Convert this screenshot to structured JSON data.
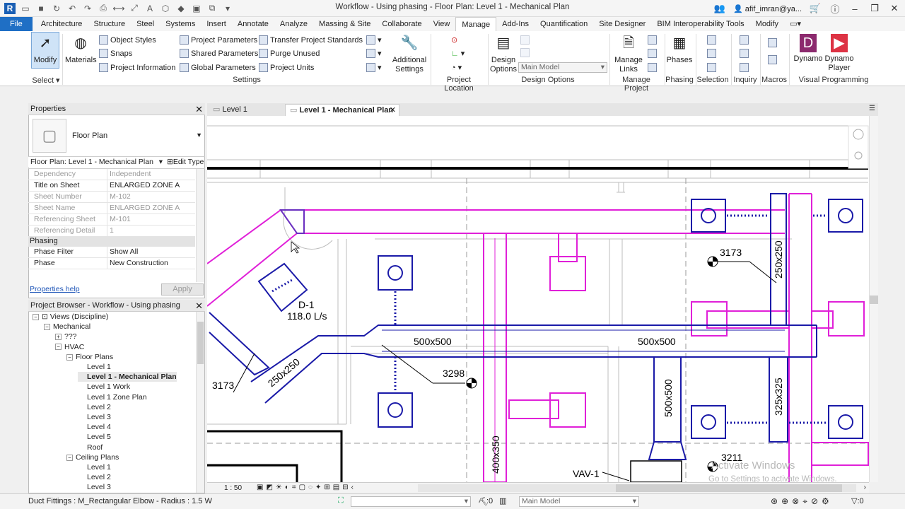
{
  "window": {
    "title": "Workflow - Using phasing - Floor Plan: Level 1 - Mechanical Plan",
    "user": "afif_imran@ya..."
  },
  "ribbon_tabs": [
    "File",
    "Architecture",
    "Structure",
    "Steel",
    "Systems",
    "Insert",
    "Annotate",
    "Analyze",
    "Massing & Site",
    "Collaborate",
    "View",
    "Manage",
    "Add-Ins",
    "Quantification",
    "Site Designer",
    "BIM Interoperability Tools",
    "Modify"
  ],
  "active_tab": "Manage",
  "ribbon": {
    "modify": "Modify",
    "select_group": "Select",
    "materials": "Materials",
    "object_styles": "Object  Styles",
    "snaps": "Snaps",
    "project_information": "Project  Information",
    "project_parameters": "Project  Parameters",
    "shared_parameters": "Shared  Parameters",
    "global_parameters": "Global  Parameters",
    "transfer_standards": "Transfer  Project Standards",
    "purge_unused": "Purge  Unused",
    "project_units": "Project  Units",
    "additional_settings_1": "Additional",
    "additional_settings_2": "Settings",
    "settings_group": "Settings",
    "project_location_group": "Project Location",
    "design_options_1": "Design",
    "design_options_2": "Options",
    "main_model": "Main Model",
    "design_options_group": "Design Options",
    "manage_links_1": "Manage",
    "manage_links_2": "Links",
    "manage_project_group": "Manage Project",
    "phases": "Phases",
    "phasing_group": "Phasing",
    "selection_group": "Selection",
    "inquiry_group": "Inquiry",
    "macros_group": "Macros",
    "dynamo": "Dynamo",
    "dynamo_player_1": "Dynamo",
    "dynamo_player_2": "Player",
    "visual_programming_group": "Visual Programming"
  },
  "properties": {
    "header": "Properties",
    "type_name": "Floor Plan",
    "selector": "Floor Plan: Level 1 - Mechanical Plan",
    "edit_type": "Edit Type",
    "rows": [
      {
        "k": "Dependency",
        "v": "Independent",
        "dim": true
      },
      {
        "k": "Title on Sheet",
        "v": "ENLARGED ZONE A",
        "dim": false
      },
      {
        "k": "Sheet Number",
        "v": "M-102",
        "dim": true
      },
      {
        "k": "Sheet Name",
        "v": "ENLARGED ZONE A",
        "dim": true
      },
      {
        "k": "Referencing Sheet",
        "v": "M-101",
        "dim": true
      },
      {
        "k": "Referencing Detail",
        "v": "1",
        "dim": true
      }
    ],
    "phasing_section": "Phasing",
    "phase_rows": [
      {
        "k": "Phase Filter",
        "v": "Show All"
      },
      {
        "k": "Phase",
        "v": "New Construction"
      }
    ],
    "help_link": "Properties help",
    "apply": "Apply"
  },
  "browser": {
    "header": "Project Browser - Workflow - Using phasing",
    "items": [
      {
        "label": "Views (Discipline)",
        "level": 0,
        "toggle": "−"
      },
      {
        "label": "Mechanical",
        "level": 1,
        "toggle": "−"
      },
      {
        "label": "???",
        "level": 2,
        "toggle": "+"
      },
      {
        "label": "HVAC",
        "level": 2,
        "toggle": "−"
      },
      {
        "label": "Floor Plans",
        "level": 3,
        "toggle": "−"
      },
      {
        "label": "Level 1",
        "level": 4,
        "toggle": ""
      },
      {
        "label": "Level 1 - Mechanical Plan",
        "level": 4,
        "toggle": "",
        "bold": true
      },
      {
        "label": "Level 1 Work",
        "level": 4,
        "toggle": ""
      },
      {
        "label": "Level 1 Zone Plan",
        "level": 4,
        "toggle": ""
      },
      {
        "label": "Level 2",
        "level": 4,
        "toggle": ""
      },
      {
        "label": "Level 3",
        "level": 4,
        "toggle": ""
      },
      {
        "label": "Level 4",
        "level": 4,
        "toggle": ""
      },
      {
        "label": "Level 5",
        "level": 4,
        "toggle": ""
      },
      {
        "label": "Roof",
        "level": 4,
        "toggle": ""
      },
      {
        "label": "Ceiling Plans",
        "level": 3,
        "toggle": "−"
      },
      {
        "label": "Level 1",
        "level": 4,
        "toggle": ""
      },
      {
        "label": "Level 2",
        "level": 4,
        "toggle": ""
      },
      {
        "label": "Level 3",
        "level": 4,
        "toggle": ""
      }
    ]
  },
  "view_tabs": [
    {
      "label": "Level 1",
      "active": false
    },
    {
      "label": "Level 1 - Mechanical Plan",
      "active": true
    }
  ],
  "drawing_labels": {
    "d1": "D-1",
    "d1_flow": "118.0 L/s",
    "duct_a": "500x500",
    "duct_b": "500x500",
    "tag_3298": "3298",
    "tag_3173_a": "3173",
    "tag_3173_b": "3173",
    "tag_3211": "3211",
    "duct_250a": "250x250",
    "duct_250b": "250x250",
    "duct_500v": "500x500",
    "duct_325": "325x325",
    "duct_400": "400x350",
    "vav": "VAV-1",
    "watermark_1": "Activate Windows",
    "watermark_2": "Go to Settings to activate Windows."
  },
  "viewbar": {
    "scale": "1 : 50"
  },
  "status": {
    "text": "Duct Fittings : M_Rectangular Elbow - Radius : 1.5 W",
    "zero": ":0",
    "model": "Main Model"
  },
  "colors": {
    "supply": "#1a1aa8",
    "return": "#e020d8",
    "accent": "#1f6fc5"
  }
}
